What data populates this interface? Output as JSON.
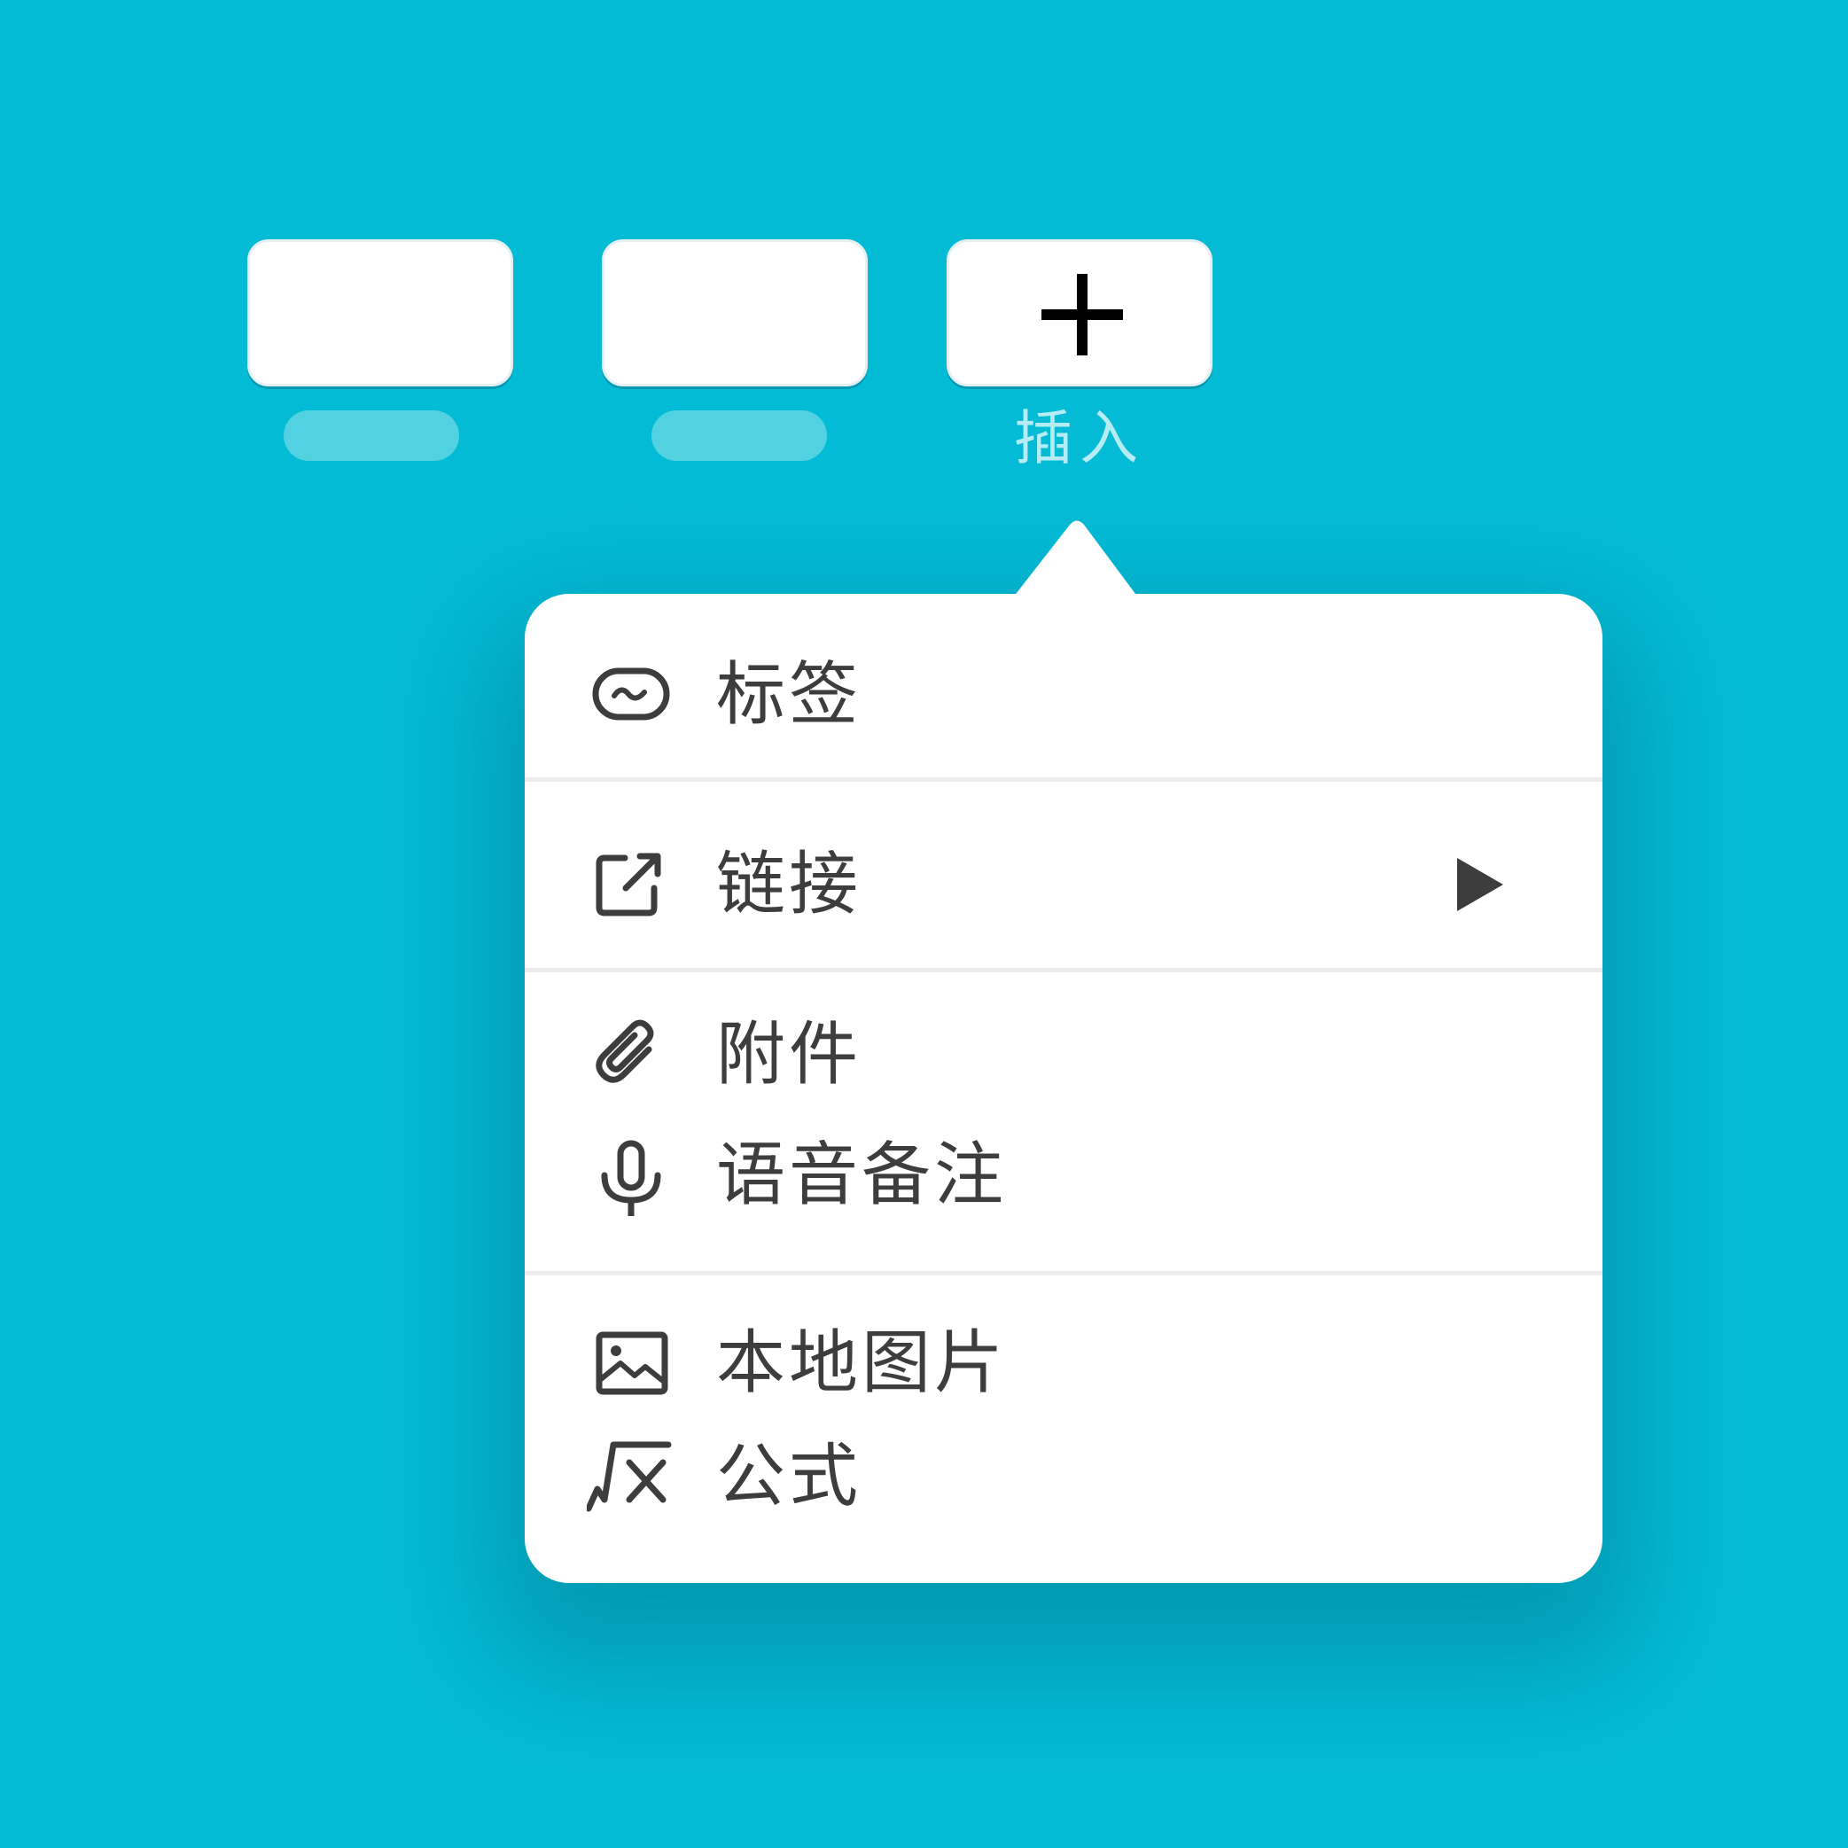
{
  "toolbar": {
    "insert_label": "插入"
  },
  "menu": {
    "items": [
      {
        "label": "标签",
        "icon": "tag-icon"
      },
      {
        "label": "链接",
        "icon": "external-link-icon",
        "submenu": true
      },
      {
        "label": "附件",
        "icon": "paperclip-icon"
      },
      {
        "label": "语音备注",
        "icon": "microphone-icon"
      },
      {
        "label": "本地图片",
        "icon": "image-icon"
      },
      {
        "label": "公式",
        "icon": "formula-icon"
      }
    ]
  },
  "colors": {
    "background": "#04bbd6",
    "menu_background": "#ffffff",
    "text": "#3d3d3d",
    "insert_label": "#b6ecf3",
    "placeholder_pill": "#52d1e1"
  }
}
